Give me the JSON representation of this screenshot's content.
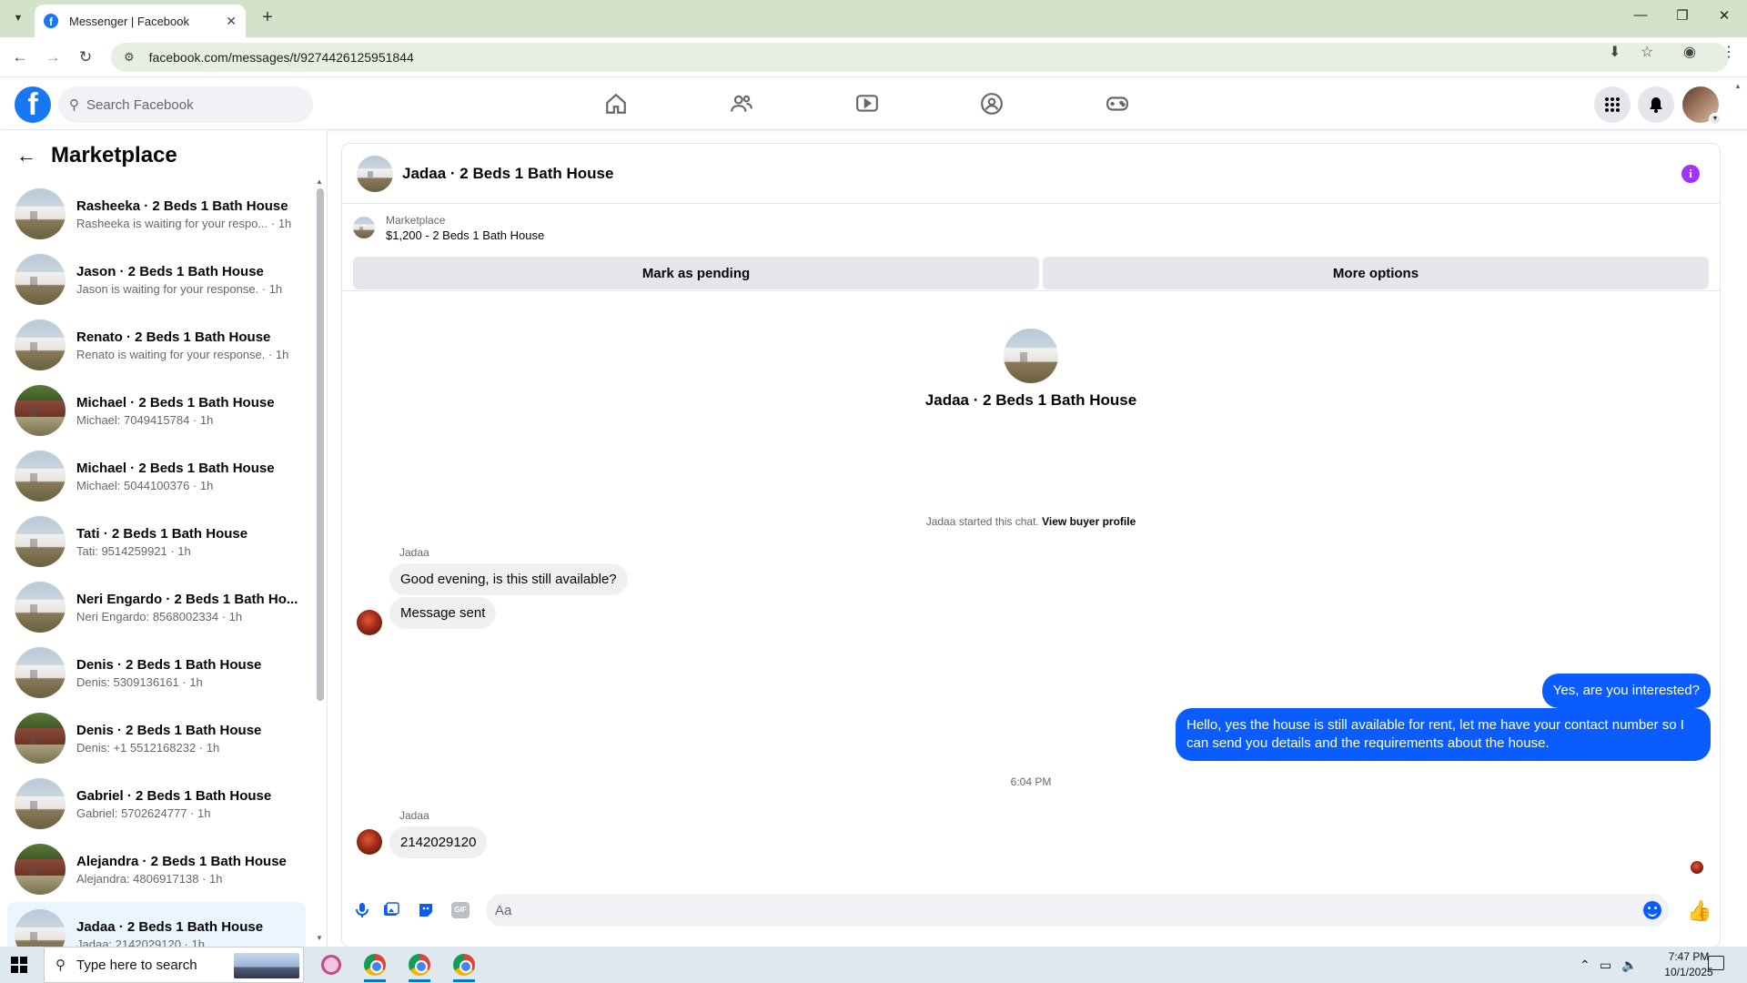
{
  "browser": {
    "tab_title": "Messenger | Facebook",
    "new_tab": "+",
    "url": "facebook.com/messages/t/9274426125951844"
  },
  "fb": {
    "search_placeholder": "Search Facebook",
    "brand_color": "#1877f2"
  },
  "sidebar": {
    "title": "Marketplace",
    "conversations": [
      {
        "name": "Rasheeka · 2 Beds 1 Bath House",
        "snippet": "Rasheeka is waiting for your respo... · 1h",
        "thumb": "white"
      },
      {
        "name": "Jason · 2 Beds 1 Bath House",
        "snippet": "Jason is waiting for your response. · 1h",
        "thumb": "white"
      },
      {
        "name": "Renato · 2 Beds 1 Bath House",
        "snippet": "Renato is waiting for your response. · 1h",
        "thumb": "white"
      },
      {
        "name": "Michael · 2 Beds 1 Bath House",
        "snippet": "Michael: 7049415784 · 1h",
        "thumb": "brick"
      },
      {
        "name": "Michael · 2 Beds 1 Bath House",
        "snippet": "Michael: 5044100376 · 1h",
        "thumb": "white"
      },
      {
        "name": "Tati · 2 Beds 1 Bath House",
        "snippet": "Tati: 9514259921 · 1h",
        "thumb": "white"
      },
      {
        "name": "Neri Engardo · 2 Beds 1 Bath Ho...",
        "snippet": "Neri Engardo: 8568002334 · 1h",
        "thumb": "white"
      },
      {
        "name": "Denis · 2 Beds 1 Bath House",
        "snippet": "Denis: 5309136161 · 1h",
        "thumb": "white"
      },
      {
        "name": "Denis · 2 Beds 1 Bath House",
        "snippet": "Denis: +1 5512168232 · 1h",
        "thumb": "brick"
      },
      {
        "name": "Gabriel · 2 Beds 1 Bath House",
        "snippet": "Gabriel: 5702624777 · 1h",
        "thumb": "white"
      },
      {
        "name": "Alejandra · 2 Beds 1 Bath House",
        "snippet": "Alejandra: 4806917138 · 1h",
        "thumb": "brick"
      },
      {
        "name": "Jadaa · 2 Beds 1 Bath House",
        "snippet": "Jadaa: 2142029120 · 1h",
        "thumb": "white",
        "active": true
      }
    ]
  },
  "chat": {
    "title": "Jadaa · 2 Beds 1 Bath House",
    "listing_label": "Marketplace",
    "listing_price": "$1,200 - 2 Beds 1 Bath House",
    "mark_pending": "Mark as pending",
    "more_options": "More options",
    "hero_name": "Jadaa · 2 Beds 1 Bath House",
    "started_text": "Jadaa started this chat.",
    "view_profile": "View buyer profile",
    "sender": "Jadaa",
    "msg1": "Good evening, is this still available?",
    "msg2": "Message sent",
    "out1": "Yes, are you interested?",
    "out2": "Hello, yes the house is still available for rent, let me have your contact number so I can send you details and the requirements about the house.",
    "timestamp": "6:04 PM",
    "sender2": "Jadaa",
    "msg3": "2142029120",
    "composer_placeholder": "Aa",
    "accent": "#0a5cff"
  },
  "taskbar": {
    "search_placeholder": "Type here to search",
    "time": "7:47 PM",
    "date": "10/1/2025"
  }
}
